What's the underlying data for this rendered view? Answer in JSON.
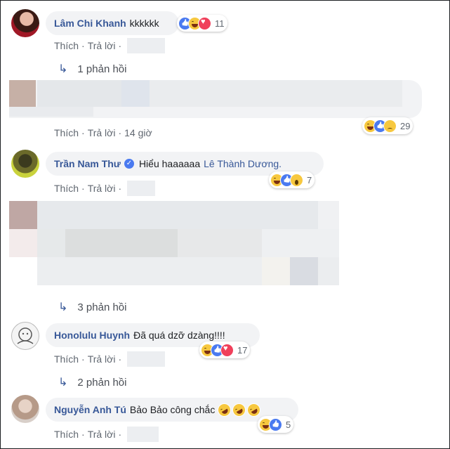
{
  "comments": [
    {
      "author": "Lâm Chi Khanh",
      "text": "kkkkkk",
      "reactions": {
        "icons": [
          "like-icon",
          "haha-icon",
          "love-icon"
        ],
        "count": "11"
      },
      "actions": {
        "like": "Thích",
        "reply": "Trả lời"
      },
      "replies_label": "1 phản hồi"
    },
    {
      "actions": {
        "like": "Thích",
        "reply": "Trả lời",
        "time": "14 giờ"
      },
      "reactions": {
        "icons": [
          "haha-icon",
          "like-icon",
          "sad-icon"
        ],
        "count": "29"
      }
    },
    {
      "author": "Trần Nam Thư",
      "verified": true,
      "text": "Hiểu haaaaaa",
      "mention": "Lê Thành Dương.",
      "reactions": {
        "icons": [
          "haha-icon",
          "like-icon",
          "wow-icon"
        ],
        "count": "7"
      },
      "actions": {
        "like": "Thích",
        "reply": "Trả lời"
      },
      "replies_label": "3 phản hồi"
    },
    {
      "author": "Honolulu Huynh",
      "text": "Đã quá dzỡ dzàng!!!!",
      "reactions": {
        "icons": [
          "haha-icon",
          "like-icon",
          "love-icon"
        ],
        "count": "17"
      },
      "actions": {
        "like": "Thích",
        "reply": "Trả lời"
      },
      "replies_label": "2 phản hồi"
    },
    {
      "author": "Nguyễn Anh Tú",
      "text": "Bảo Bảo công chắc",
      "reactions": {
        "icons": [
          "haha-icon",
          "like-icon"
        ],
        "count": "5"
      },
      "actions": {
        "like": "Thích",
        "reply": "Trả lời"
      }
    }
  ],
  "colors": {
    "name": "#385898",
    "bubble": "#f2f3f5",
    "meta": "#606770",
    "like": "#4a7af0",
    "love": "#f0405b",
    "haha": "#f7c83f"
  }
}
